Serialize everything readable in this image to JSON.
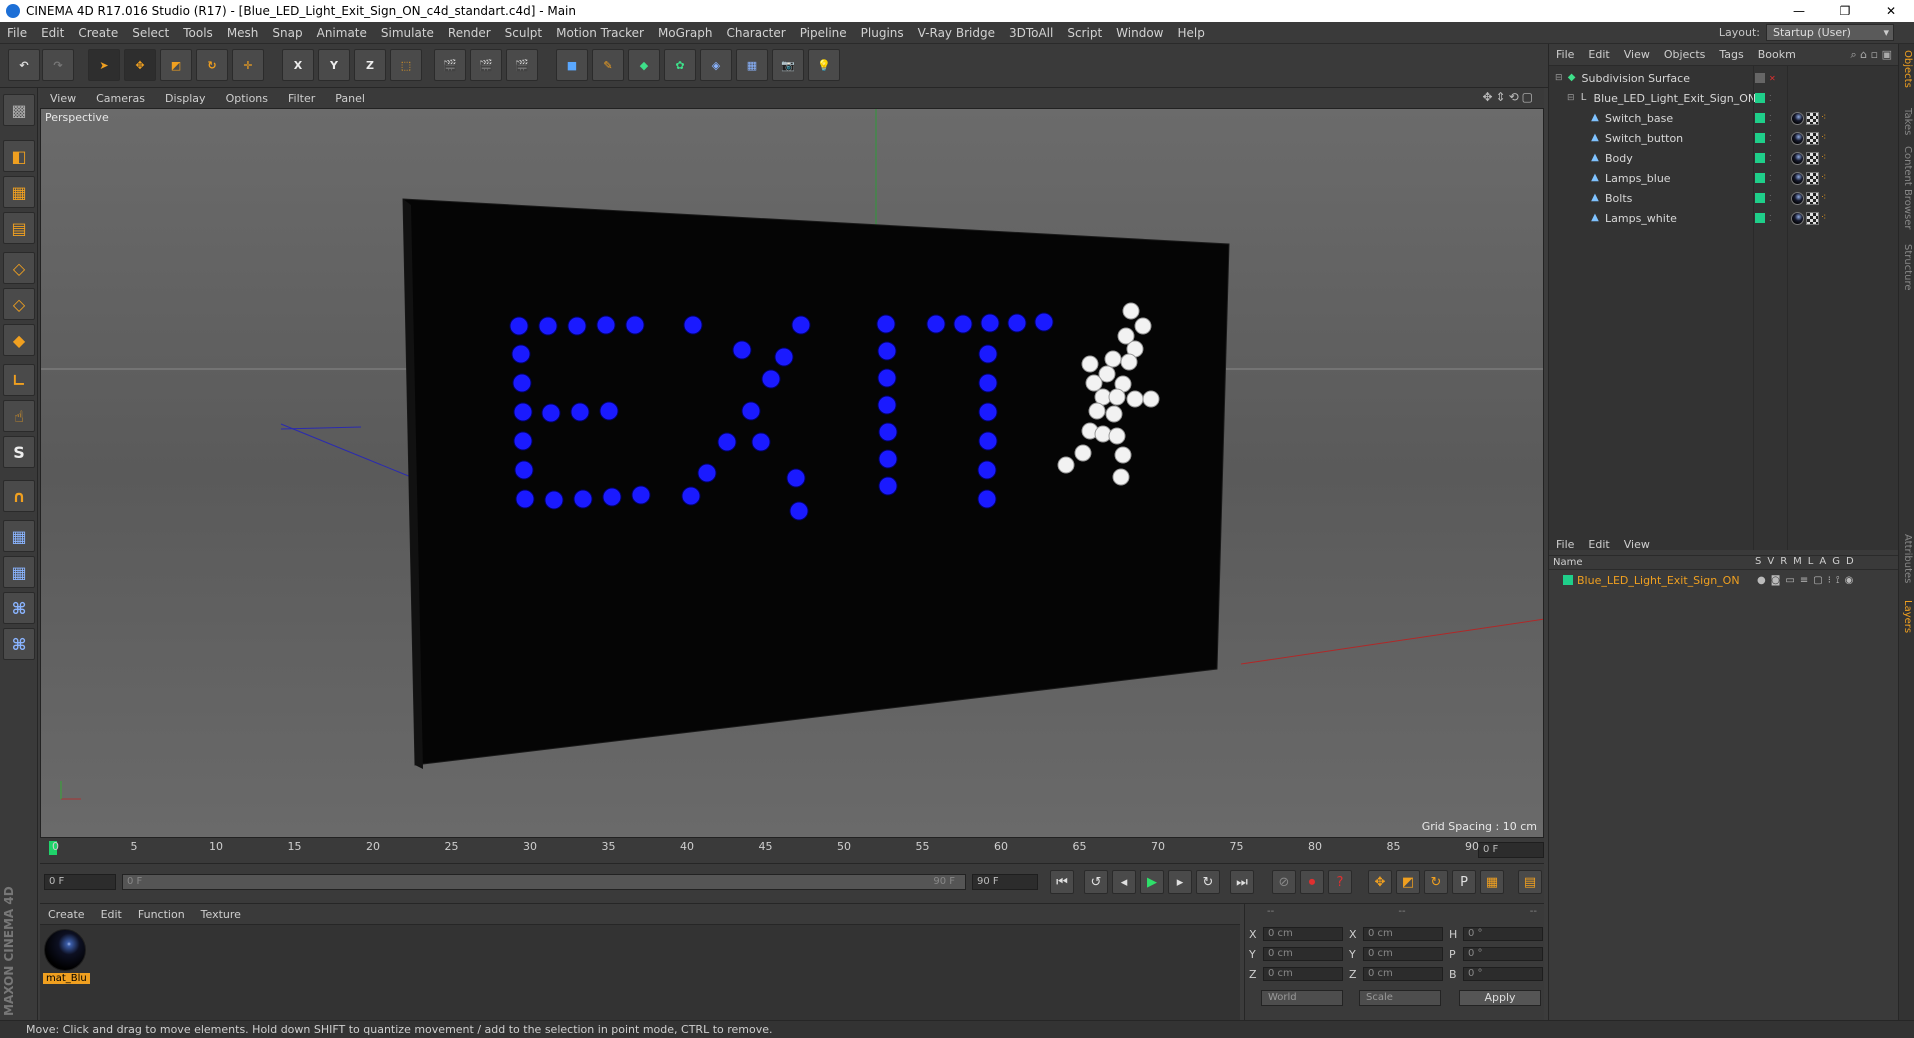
{
  "titlebar": {
    "title": "CINEMA 4D R17.016 Studio (R17) - [Blue_LED_Light_Exit_Sign_ON_c4d_standart.c4d] - Main",
    "minimize": "—",
    "restore": "❐",
    "close": "✕"
  },
  "menubar": {
    "items": [
      "File",
      "Edit",
      "Create",
      "Select",
      "Tools",
      "Mesh",
      "Snap",
      "Animate",
      "Simulate",
      "Render",
      "Sculpt",
      "Motion Tracker",
      "MoGraph",
      "Character",
      "Pipeline",
      "Plugins",
      "V-Ray Bridge",
      "3DToAll",
      "Script",
      "Window",
      "Help"
    ],
    "layout_label": "Layout:",
    "layout_value": "Startup (User)"
  },
  "toolbar": {
    "axis_x": "X",
    "axis_y": "Y",
    "axis_z": "Z"
  },
  "viewport": {
    "menu": [
      "View",
      "Cameras",
      "Display",
      "Options",
      "Filter",
      "Panel"
    ],
    "label": "Perspective",
    "grid_spacing": "Grid Spacing : 10 cm",
    "sign_text": "EXIT"
  },
  "timeline": {
    "ticks": [
      "0",
      "5",
      "10",
      "15",
      "20",
      "25",
      "30",
      "35",
      "40",
      "45",
      "50",
      "55",
      "60",
      "65",
      "70",
      "75",
      "80",
      "85",
      "90"
    ],
    "current_frame": "0 F"
  },
  "transport": {
    "start_frame": "0 F",
    "slider_left": "0 F",
    "slider_right": "90 F",
    "end_frame": "90 F"
  },
  "material_panel": {
    "menu": [
      "Create",
      "Edit",
      "Function",
      "Texture"
    ],
    "material_name": "mat_Blu"
  },
  "coordinates": {
    "header": [
      "--",
      "--",
      "--"
    ],
    "rows": [
      {
        "l1": "X",
        "v1": "0 cm",
        "l2": "X",
        "v2": "0 cm",
        "l3": "H",
        "v3": "0 °"
      },
      {
        "l1": "Y",
        "v1": "0 cm",
        "l2": "Y",
        "v2": "0 cm",
        "l3": "P",
        "v3": "0 °"
      },
      {
        "l1": "Z",
        "v1": "0 cm",
        "l2": "Z",
        "v2": "0 cm",
        "l3": "B",
        "v3": "0 °"
      }
    ],
    "mode1": "World",
    "mode2": "Scale",
    "apply": "Apply"
  },
  "status": "Move: Click and drag to move elements. Hold down SHIFT to quantize movement / add to the selection in point mode, CTRL to remove.",
  "objects_panel": {
    "menu": [
      "File",
      "Edit",
      "View",
      "Objects",
      "Tags",
      "Bookm"
    ],
    "items": [
      {
        "name": "Subdivision Surface",
        "level": 0
      },
      {
        "name": "Blue_LED_Light_Exit_Sign_ON",
        "level": 1
      },
      {
        "name": "Switch_base",
        "level": 2
      },
      {
        "name": "Switch_button",
        "level": 2
      },
      {
        "name": "Body",
        "level": 2
      },
      {
        "name": "Lamps_blue",
        "level": 2
      },
      {
        "name": "Bolts",
        "level": 2
      },
      {
        "name": "Lamps_white",
        "level": 2
      }
    ]
  },
  "layers_panel": {
    "menu": [
      "File",
      "Edit",
      "View"
    ],
    "name_col": "Name",
    "cols": [
      "S",
      "V",
      "R",
      "M",
      "L",
      "A",
      "G",
      "D"
    ],
    "row": "Blue_LED_Light_Exit_Sign_ON"
  },
  "side_tabs": [
    "Objects",
    "Takes",
    "Content Browser",
    "Structure",
    "Attributes",
    "Layers"
  ],
  "maxon": "MAXON CINEMA 4D",
  "colors": {
    "accent": "#f0a020",
    "led_blue": "#1a1aff",
    "led_white": "#f2f2f2",
    "layer_green": "#1fcf8a"
  }
}
